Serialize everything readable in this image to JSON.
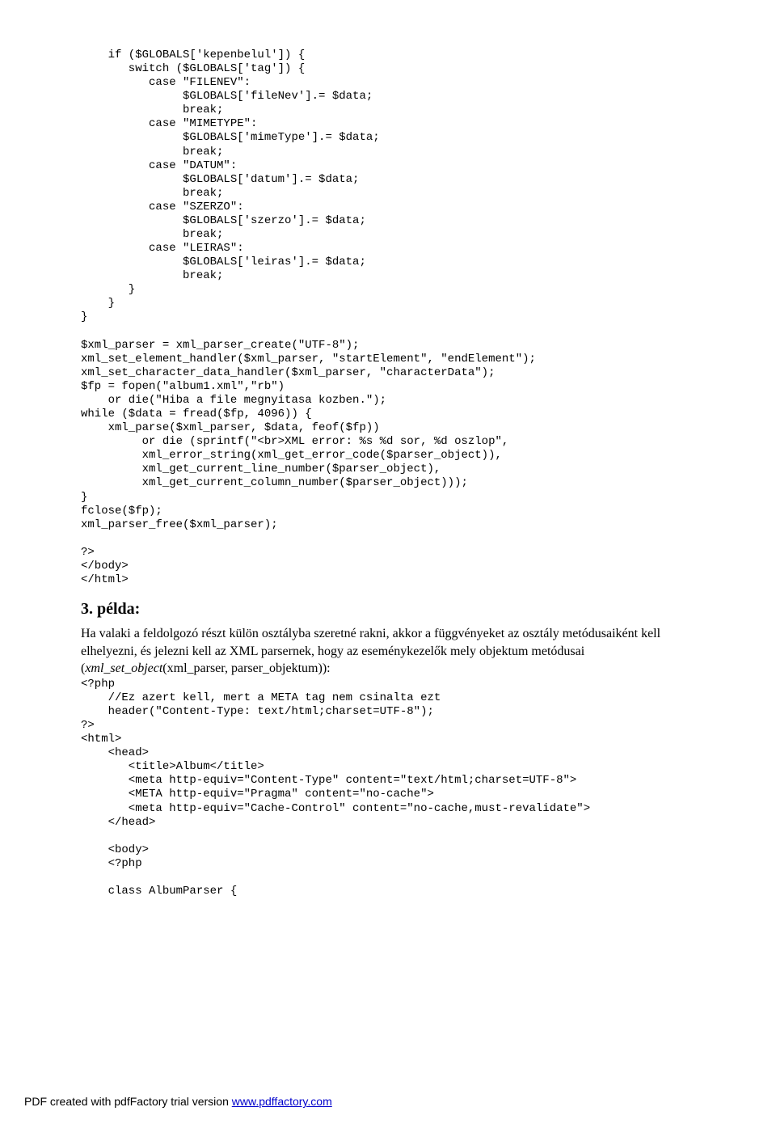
{
  "code1": "    if ($GLOBALS['kepenbelul']) {\n       switch ($GLOBALS['tag']) {\n          case \"FILENEV\":\n               $GLOBALS['fileNev'].= $data;\n               break;\n          case \"MIMETYPE\":\n               $GLOBALS['mimeType'].= $data;\n               break;\n          case \"DATUM\":\n               $GLOBALS['datum'].= $data;\n               break;\n          case \"SZERZO\":\n               $GLOBALS['szerzo'].= $data;\n               break;\n          case \"LEIRAS\":\n               $GLOBALS['leiras'].= $data;\n               break;\n       }\n    }\n}\n\n$xml_parser = xml_parser_create(\"UTF-8\");\nxml_set_element_handler($xml_parser, \"startElement\", \"endElement\");\nxml_set_character_data_handler($xml_parser, \"characterData\");\n$fp = fopen(\"album1.xml\",\"rb\")\n    or die(\"Hiba a file megnyitasa kozben.\");\nwhile ($data = fread($fp, 4096)) {\n    xml_parse($xml_parser, $data, feof($fp))\n         or die (sprintf(\"<br>XML error: %s %d sor, %d oszlop\",\n         xml_error_string(xml_get_error_code($parser_object)),\n         xml_get_current_line_number($parser_object),\n         xml_get_current_column_number($parser_object)));\n}\nfclose($fp);\nxml_parser_free($xml_parser);\n\n?>\n</body>\n</html>",
  "heading": "3. példa:",
  "prose": {
    "part1": "Ha valaki a feldolgozó részt külön osztályba szeretné rakni, akkor a függvényeket az osztály metódusaiként kell elhelyezni, és jelezni kell az XML parsernek, hogy az eseménykezelők mely objektum metódusai (",
    "italic": "xml_set_object",
    "part2": "(xml_parser, parser_objektum)):"
  },
  "code2": "<?php\n    //Ez azert kell, mert a META tag nem csinalta ezt\n    header(\"Content-Type: text/html;charset=UTF-8\");\n?>\n<html>\n    <head>\n       <title>Album</title>\n       <meta http-equiv=\"Content-Type\" content=\"text/html;charset=UTF-8\">\n       <META http-equiv=\"Pragma\" content=\"no-cache\">\n       <meta http-equiv=\"Cache-Control\" content=\"no-cache,must-revalidate\">\n    </head>\n\n    <body>\n    <?php\n\n    class AlbumParser {",
  "footer": {
    "text": "PDF created with pdfFactory trial version ",
    "link": "www.pdffactory.com"
  }
}
